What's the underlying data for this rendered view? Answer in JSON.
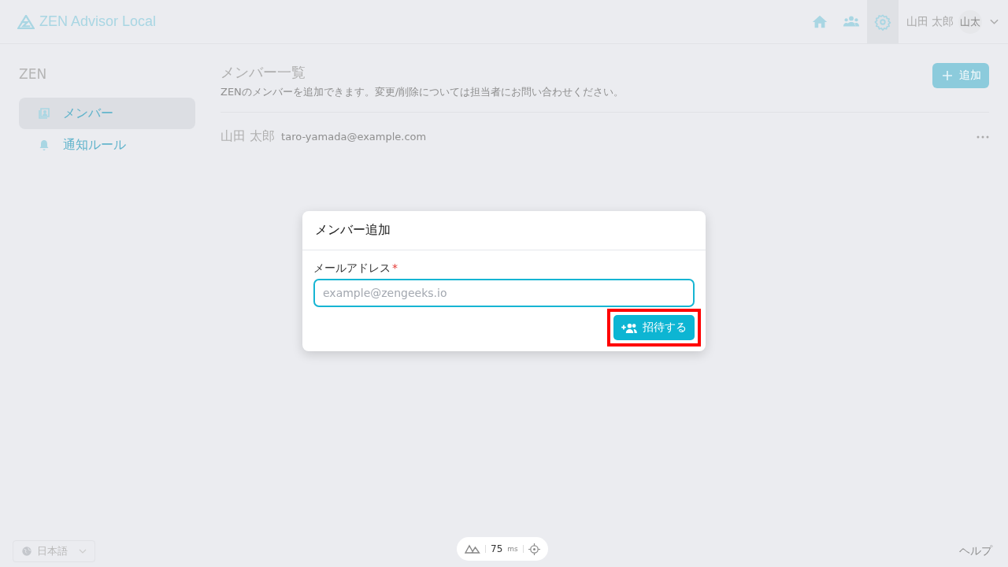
{
  "header": {
    "app_name": "ZEN Advisor Local",
    "nav": [
      {
        "kind": "home",
        "selected": false
      },
      {
        "kind": "team",
        "selected": false
      },
      {
        "kind": "settings",
        "selected": true
      }
    ],
    "user_name": "山田 太郎",
    "avatar": "山太"
  },
  "sidebar": {
    "title": "ZEN",
    "items": [
      {
        "kind": "members",
        "label": "メンバー",
        "selected": true
      },
      {
        "kind": "bell",
        "label": "通知ルール",
        "selected": false
      }
    ]
  },
  "main": {
    "title": "メンバー一覧",
    "description": "ZENのメンバーを追加できます。変更/削除については担当者にお問い合わせください。",
    "add_button": "追加",
    "members": [
      {
        "name": "山田 太郎",
        "email": "taro-yamada@example.com"
      }
    ]
  },
  "dialog": {
    "title": "メンバー追加",
    "field_label": "メールアドレス",
    "required_mark": "*",
    "placeholder": "example@zengeeks.io",
    "submit": "招待する",
    "submit_highlighted": true
  },
  "footer": {
    "language": "日本語",
    "latency": "75",
    "latency_unit": "ms",
    "help": "ヘルプ"
  }
}
